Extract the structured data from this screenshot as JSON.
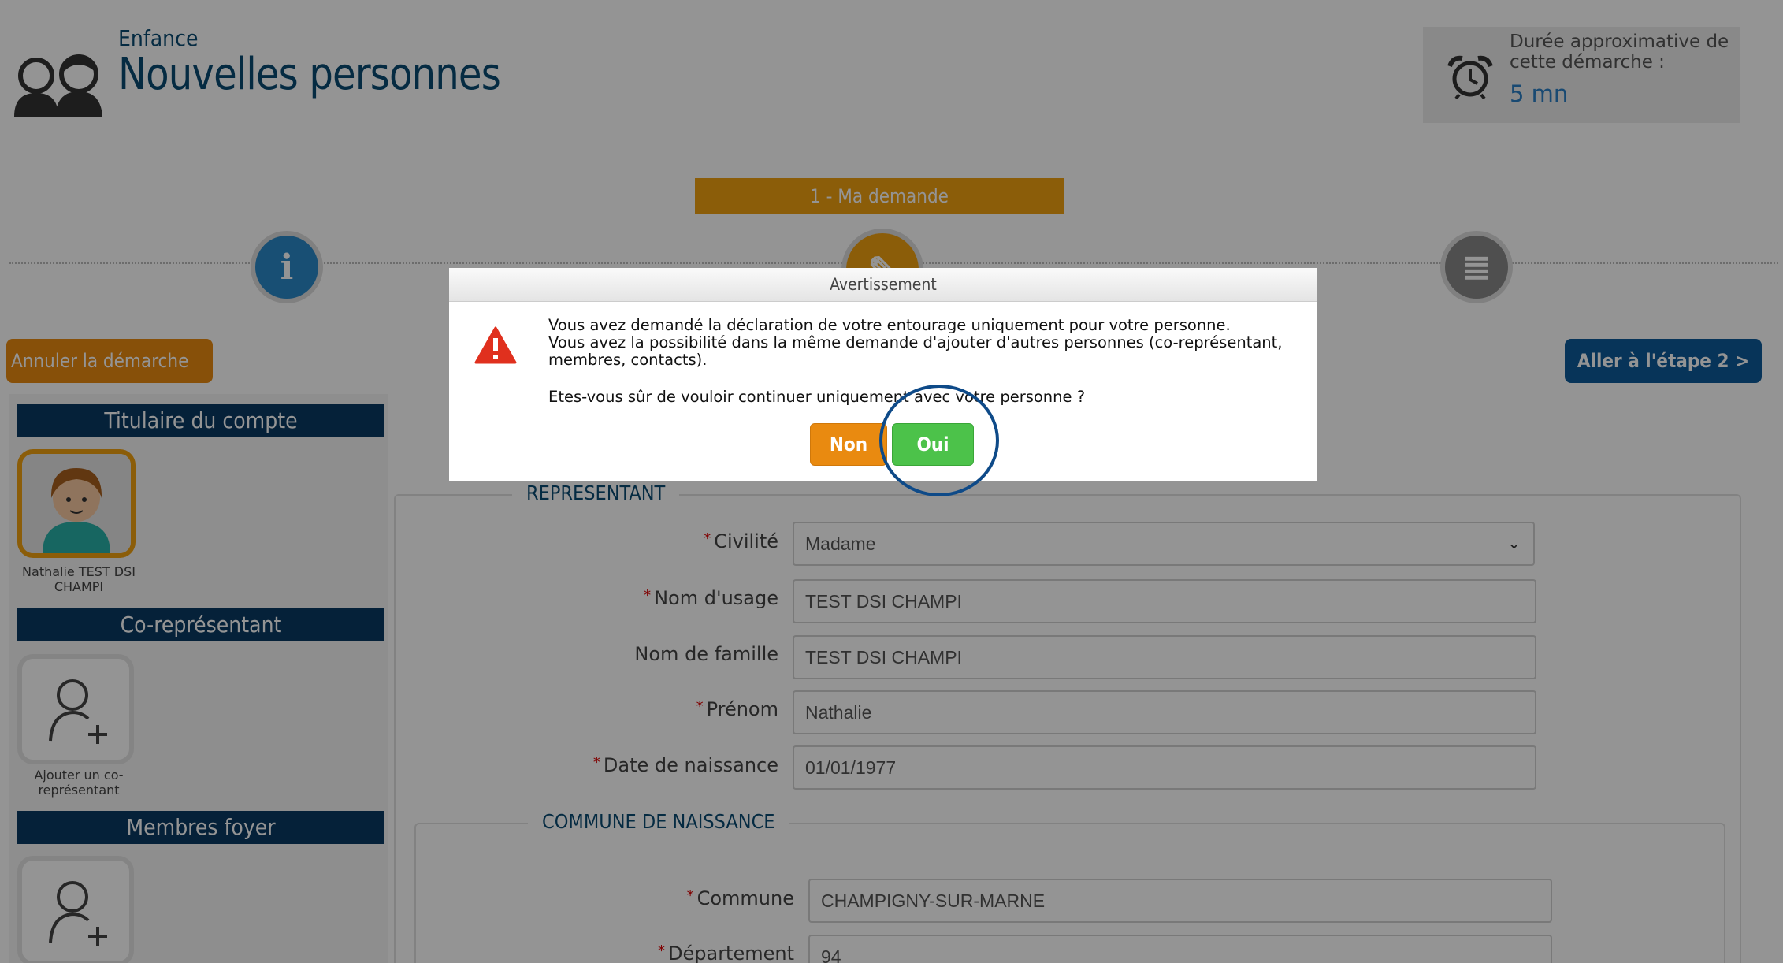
{
  "header": {
    "category": "Enfance",
    "title": "Nouvelles personnes",
    "duration_label": "Durée approximative de cette démarche :",
    "duration_value": "5 mn",
    "people_icon": "people-icon",
    "clock_icon": "alarm-clock-icon"
  },
  "stepper": {
    "current_step_label": "1 - Ma demande",
    "steps": [
      {
        "icon": "info-icon",
        "glyph": "i"
      },
      {
        "icon": "edit-icon",
        "glyph": "✎"
      },
      {
        "icon": "list-icon",
        "glyph": "≣"
      }
    ]
  },
  "actions": {
    "cancel_label": "Annuler la démarche",
    "next_label": "Aller à l'étape 2 >"
  },
  "sidebar": {
    "account_holder_header": "Titulaire du compte",
    "account_holder_name": "Nathalie TEST DSI CHAMPI",
    "co_rep_header": "Co-représentant",
    "add_co_rep_label": "Ajouter un co-représentant",
    "household_header": "Membres foyer"
  },
  "form": {
    "representant_legend": "REPRESENTANT",
    "civilite_label": "Civilité",
    "civilite_value": "Madame",
    "nom_usage_label": "Nom d'usage",
    "nom_usage_value": "TEST DSI CHAMPI",
    "nom_famille_label": "Nom de famille",
    "nom_famille_value": "TEST DSI CHAMPI",
    "prenom_label": "Prénom",
    "prenom_value": "Nathalie",
    "date_naissance_label": "Date de naissance",
    "date_naissance_value": "01/01/1977",
    "commune_legend": "COMMUNE DE NAISSANCE",
    "commune_label": "Commune",
    "commune_value": "CHAMPIGNY-SUR-MARNE",
    "departement_label": "Département",
    "departement_value": "94"
  },
  "dialog": {
    "title": "Avertissement",
    "line1": "Vous avez demandé la déclaration de votre entourage uniquement pour votre personne.",
    "line2": "Vous avez la possibilité dans la même demande d'ajouter d'autres personnes (co-représentant, membres, contacts).",
    "question": "Etes-vous sûr de vouloir continuer uniquement avec votre personne ?",
    "no_label": "Non",
    "yes_label": "Oui"
  },
  "colors": {
    "brand_blue": "#0a4a73",
    "accent_orange": "#f0a010",
    "confirm_green": "#4cc24a",
    "next_blue": "#0d5a99"
  }
}
